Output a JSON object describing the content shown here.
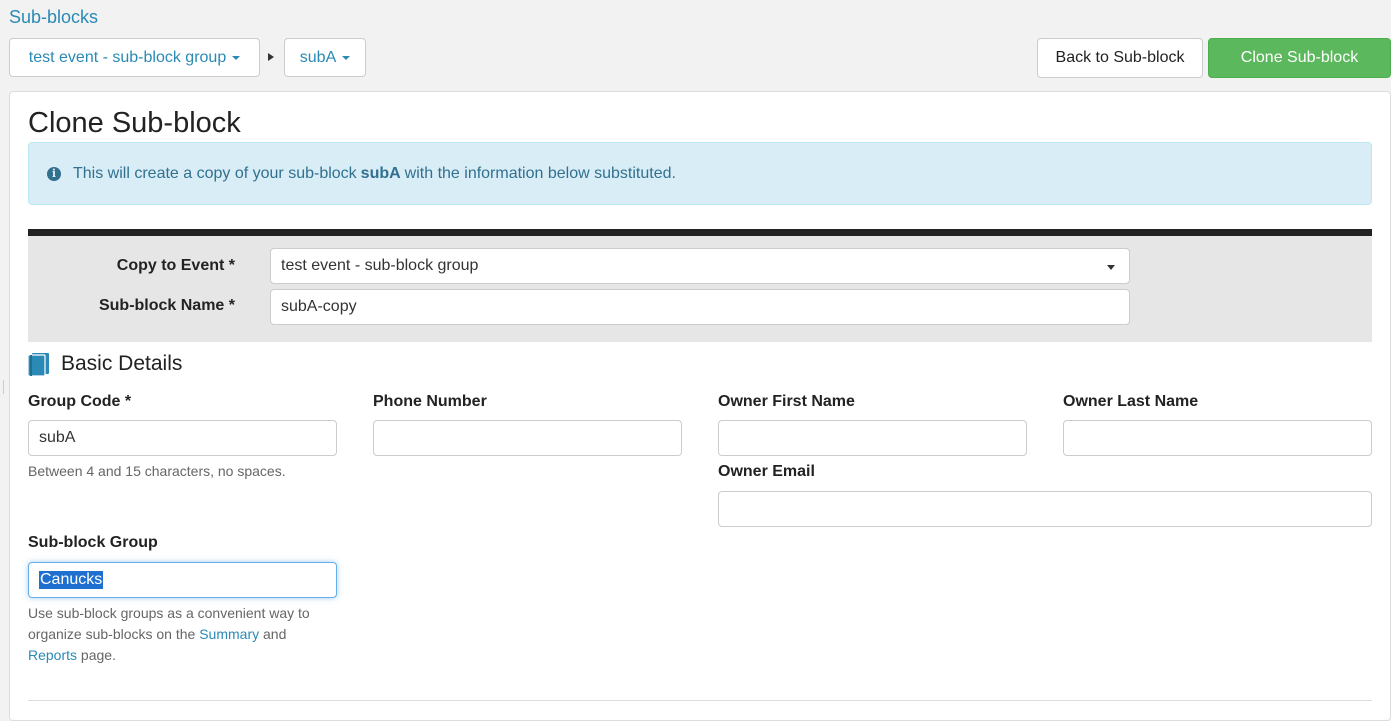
{
  "header": {
    "page_link": "Sub-blocks",
    "event_dropdown": "test event - sub-block group",
    "subblock_dropdown": "subA",
    "back_label": "Back to Sub-block",
    "clone_label": "Clone Sub-block"
  },
  "main": {
    "title": "Clone Sub-block",
    "info": {
      "prefix": "This will create a copy of your sub-block",
      "subblock": "subA",
      "suffix": "with the information below substituted."
    }
  },
  "copy_form": {
    "event_label": "Copy to Event *",
    "event_value": "test event - sub-block group",
    "name_label": "Sub-block Name *",
    "name_value": "subA-copy"
  },
  "basic_details": {
    "title": "Basic Details",
    "group_code_label": "Group Code *",
    "group_code_value": "subA",
    "group_code_help": "Between 4 and 15 characters, no spaces.",
    "phone_label": "Phone Number",
    "phone_value": "",
    "owner_first_label": "Owner First Name",
    "owner_first_value": "",
    "owner_last_label": "Owner Last Name",
    "owner_last_value": "",
    "owner_email_label": "Owner Email",
    "owner_email_value": "",
    "subblock_group_label": "Sub-block Group",
    "subblock_group_value": "Canucks",
    "subblock_group_help_1": "Use sub-block groups as a convenient way to",
    "subblock_group_help_2": "organize sub-blocks on the",
    "summary_link": "Summary",
    "help_and": "and",
    "reports_link": "Reports",
    "help_page": "page."
  },
  "colors": {
    "link": "#2a8ab5",
    "success": "#5cb85c",
    "info_bg": "#d9edf7",
    "info_text": "#31708f"
  }
}
